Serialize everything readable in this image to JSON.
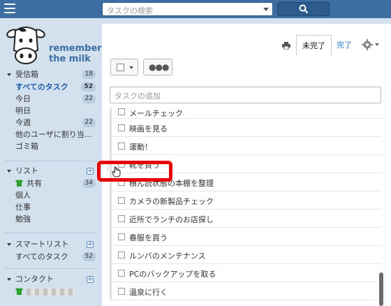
{
  "header": {
    "search_placeholder": "タスクの検索"
  },
  "logo": {
    "line1": "remember",
    "line2": "the milk"
  },
  "sidebar": {
    "inbox": {
      "title": "受信箱",
      "count": "18",
      "items": [
        {
          "label": "すべてのタスク",
          "count": "52",
          "active": true
        },
        {
          "label": "今日",
          "count": "22"
        },
        {
          "label": "明日",
          "count": ""
        },
        {
          "label": "今週",
          "count": "22"
        },
        {
          "label": "他のユーザに割り当…",
          "count": ""
        },
        {
          "label": "ゴミ箱",
          "count": ""
        }
      ]
    },
    "lists": {
      "title": "リスト",
      "items": [
        {
          "label": "共有",
          "count": "34"
        },
        {
          "label": "個人",
          "count": ""
        },
        {
          "label": "仕事",
          "count": ""
        },
        {
          "label": "勉強",
          "count": ""
        }
      ]
    },
    "smartlists": {
      "title": "スマートリスト",
      "items": [
        {
          "label": "すべてのタスク",
          "count": "52"
        }
      ]
    },
    "contacts": {
      "title": "コンタクト"
    }
  },
  "main": {
    "tabs": {
      "incomplete": "未完了",
      "complete": "完了"
    },
    "add_placeholder": "タスクの追加",
    "tasks": [
      "メールチェック",
      "映画を見る",
      "運動！",
      "靴を買う",
      "積ん読状態の本棚を整理",
      "カメラの新製品チェック",
      "近所でランチのお店探し",
      "春服を買う",
      "ルンバのメンテナンス",
      "PCのバックアップを取る",
      "温泉に行く"
    ]
  },
  "colors": {
    "topbar": "#3d6ea3",
    "sidebar": "#d3e1ee",
    "highlight": "#e60000",
    "active_link": "#1a5ca8"
  }
}
